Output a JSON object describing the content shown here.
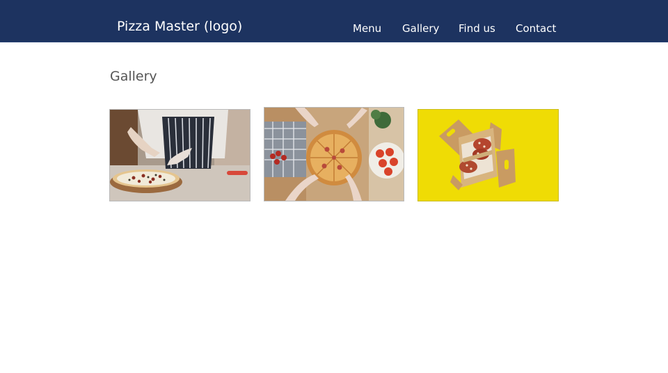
{
  "header": {
    "logo_text": "Pizza Master (logo)",
    "background": "#1d3360",
    "nav": [
      {
        "label": "Menu"
      },
      {
        "label": "Gallery"
      },
      {
        "label": "Find us"
      },
      {
        "label": "Contact"
      }
    ]
  },
  "main": {
    "title": "Gallery",
    "images": [
      {
        "subject": "chef cutting pizza on wooden board"
      },
      {
        "subject": "hands taking pizza slices from top view"
      },
      {
        "subject": "pizza box with food on yellow background"
      }
    ]
  }
}
